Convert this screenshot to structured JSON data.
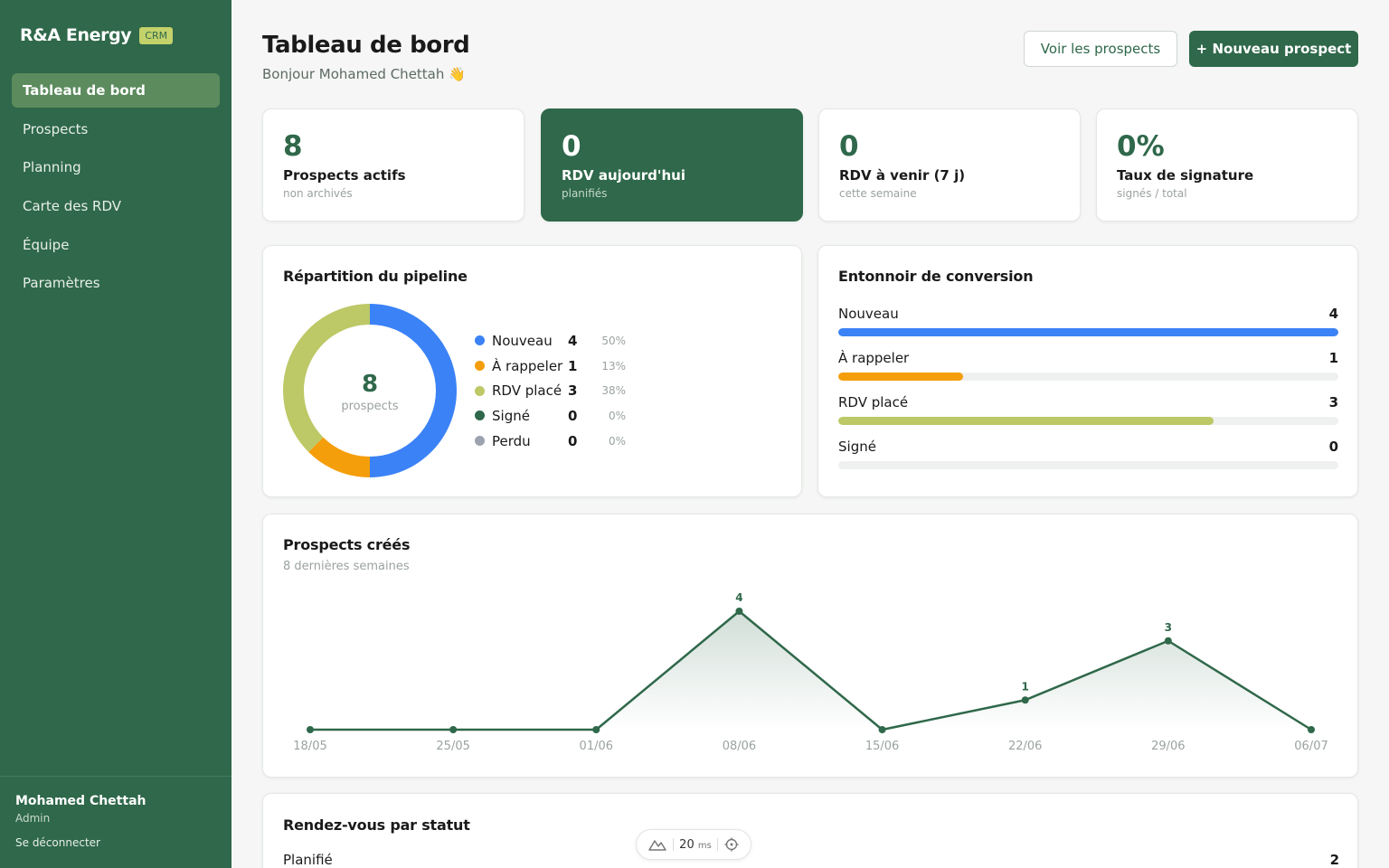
{
  "app": {
    "brand": "R&A Energy",
    "badge": "CRM"
  },
  "sidebar": {
    "items": [
      {
        "label": "Tableau de bord",
        "active": true
      },
      {
        "label": "Prospects"
      },
      {
        "label": "Planning"
      },
      {
        "label": "Carte des RDV"
      },
      {
        "label": "Équipe"
      },
      {
        "label": "Paramètres"
      }
    ],
    "user": {
      "name": "Mohamed Chettah",
      "role": "Admin"
    },
    "logout": "Se déconnecter"
  },
  "header": {
    "title": "Tableau de bord",
    "greeting": "Bonjour Mohamed Chettah 👋",
    "btn_view": "Voir les prospects",
    "btn_new": "+ Nouveau prospect"
  },
  "stats": [
    {
      "value": "8",
      "label": "Prospects actifs",
      "sub": "non archivés"
    },
    {
      "value": "0",
      "label": "RDV aujourd'hui",
      "sub": "planifiés"
    },
    {
      "value": "0",
      "label": "RDV à venir (7 j)",
      "sub": "cette semaine"
    },
    {
      "value": "0%",
      "label": "Taux de signature",
      "sub": "signés / total"
    }
  ],
  "pipeline": {
    "title": "Répartition du pipeline",
    "total": "8",
    "total_label": "prospects",
    "items": [
      {
        "name": "Nouveau",
        "count": "4",
        "pct": "50%",
        "value": 4,
        "color": "#3b82f6"
      },
      {
        "name": "À rappeler",
        "count": "1",
        "pct": "13%",
        "value": 1,
        "color": "#f59e0b"
      },
      {
        "name": "RDV placé",
        "count": "3",
        "pct": "38%",
        "value": 3,
        "color": "#bdc866"
      },
      {
        "name": "Signé",
        "count": "0",
        "pct": "0%",
        "value": 0,
        "color": "#2f684a"
      },
      {
        "name": "Perdu",
        "count": "0",
        "pct": "0%",
        "value": 0,
        "color": "#9ca3af"
      }
    ]
  },
  "funnel": {
    "title": "Entonnoir de conversion",
    "max": 4,
    "items": [
      {
        "name": "Nouveau",
        "value": "4",
        "n": 4,
        "color": "#3b82f6"
      },
      {
        "name": "À rappeler",
        "value": "1",
        "n": 1,
        "color": "#f59e0b"
      },
      {
        "name": "RDV placé",
        "value": "3",
        "n": 3,
        "color": "#bdc866"
      },
      {
        "name": "Signé",
        "value": "0",
        "n": 0,
        "color": "#2f684a"
      }
    ]
  },
  "created": {
    "title": "Prospects créés",
    "subtitle": "8 dernières semaines"
  },
  "chart_data": {
    "type": "area",
    "title": "Prospects créés",
    "subtitle": "8 dernières semaines",
    "categories": [
      "18/05",
      "25/05",
      "01/06",
      "08/06",
      "15/06",
      "22/06",
      "29/06",
      "06/07"
    ],
    "series": [
      {
        "values": [
          0,
          0,
          0,
          4,
          0,
          1,
          3,
          0
        ],
        "color": "#2f684a"
      }
    ],
    "data_labels": [
      "",
      "",
      "",
      "4",
      "",
      "1",
      "3",
      ""
    ],
    "ylim": [
      0,
      4
    ],
    "grid": false
  },
  "rdv": {
    "title": "Rendez-vous par statut",
    "rows": [
      {
        "name": "Planifié",
        "value": "2"
      }
    ]
  },
  "perf": {
    "value": "20",
    "unit": "ms"
  }
}
